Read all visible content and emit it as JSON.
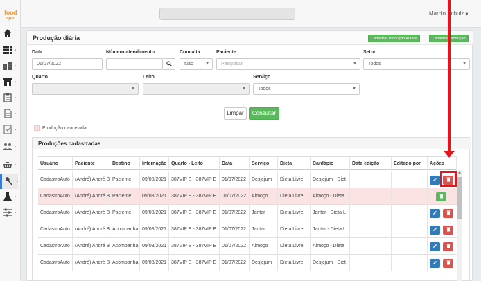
{
  "app": {
    "logo_line1": "food",
    "logo_line2": "ope",
    "user_name": "Marcio Schulz"
  },
  "page": {
    "title": "Produção diária",
    "btn_add_avulsa": "Cadastrar Produção Avulsa",
    "btn_add": "Cadastrar produção"
  },
  "filters": {
    "data_label": "Data",
    "data_value": "01/07/2022",
    "atendimento_label": "Número atendimento",
    "atendimento_value": "",
    "alta_label": "Com alta",
    "alta_value": "Não",
    "paciente_label": "Paciente",
    "paciente_placeholder": "Pesquisar",
    "setor_label": "Setor",
    "setor_value": "Todos",
    "quarto_label": "Quarto",
    "leito_label": "Leito",
    "servico_label": "Serviço",
    "servico_value": "Todos",
    "btn_limpar": "Limpar",
    "btn_consultar": "Consultar"
  },
  "legend": {
    "cancelled": "Produção cancelada"
  },
  "table": {
    "section_title": "Produções cadastradas",
    "columns": [
      "Usuário",
      "Paciente",
      "Destino",
      "Internação",
      "Quarto - Leito",
      "Data",
      "Serviço",
      "Dieta",
      "Cardápio",
      "Data edição",
      "Editado por",
      "Ações"
    ],
    "rows": [
      {
        "usuario": "CadastroAuto",
        "paciente": "(André) André B",
        "destino": "Paciente",
        "internacao": "09/08/2021",
        "quarto": "387VIP E - 387VIP E",
        "data": "01/07/2022",
        "servico": "Desjejum",
        "dieta": "Dieta Livre",
        "cardapio": "Desjejum - Diet",
        "data_edicao": "",
        "editado_por": ""
      },
      {
        "usuario": "CadastroAuto",
        "paciente": "(André) André B",
        "destino": "Paciente",
        "internacao": "09/08/2021",
        "quarto": "387VIP E - 387VIP E",
        "data": "01/07/2022",
        "servico": "Almoço",
        "dieta": "Dieta Livre",
        "cardapio": "Almoço - Dieta",
        "data_edicao": "",
        "editado_por": ""
      },
      {
        "usuario": "CadastroAuto",
        "paciente": "(André) André B",
        "destino": "Paciente",
        "internacao": "09/08/2021",
        "quarto": "387VIP E - 387VIP E",
        "data": "01/07/2022",
        "servico": "Jantar",
        "dieta": "Dieta Livre",
        "cardapio": "Jantar - Dieta L",
        "data_edicao": "",
        "editado_por": ""
      },
      {
        "usuario": "CadastroAuto",
        "paciente": "(André) André B",
        "destino": "Acompanha",
        "internacao": "09/08/2021",
        "quarto": "387VIP E - 387VIP E",
        "data": "01/07/2022",
        "servico": "Jantar",
        "dieta": "Dieta Livre",
        "cardapio": "Jantar - Dieta L",
        "data_edicao": "",
        "editado_por": ""
      },
      {
        "usuario": "CadastroAuto",
        "paciente": "(André) André B",
        "destino": "Acompanha",
        "internacao": "09/08/2021",
        "quarto": "387VIP E - 387VIP E",
        "data": "01/07/2022",
        "servico": "Almoço",
        "dieta": "Dieta Livre",
        "cardapio": "Almoço - Dieta",
        "data_edicao": "",
        "editado_por": ""
      },
      {
        "usuario": "CadastroAuto",
        "paciente": "(André) André B",
        "destino": "Acompanha",
        "internacao": "09/08/2021",
        "quarto": "387VIP E - 387VIP E",
        "data": "01/07/2022",
        "servico": "Desjejum",
        "dieta": "Dieta Livre",
        "cardapio": "Desjejum - Diet",
        "data_edicao": "",
        "editado_por": ""
      }
    ]
  },
  "icons": {
    "edit": "pencil-icon",
    "delete": "trash-icon",
    "restore": "restore-icon",
    "search": "search-icon"
  },
  "colors": {
    "success": "#5cb85c",
    "primary": "#337ab7",
    "danger": "#d9534f",
    "cancelled_row": "#fbe3e3",
    "annotation": "#e8141c"
  }
}
